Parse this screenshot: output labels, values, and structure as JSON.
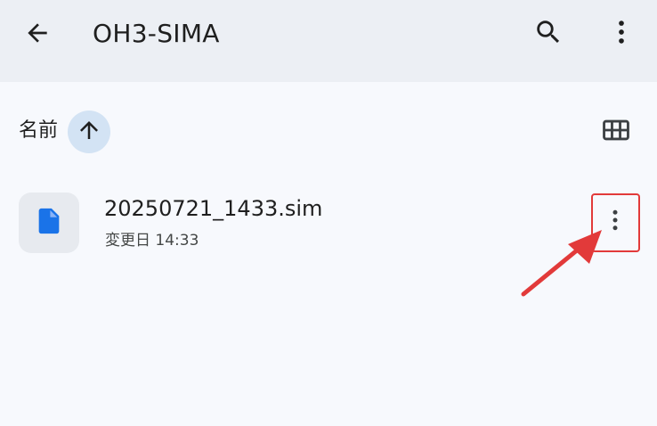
{
  "header": {
    "title": "OH3-SIMA",
    "back_icon": "arrow-back-icon",
    "search_icon": "search-icon",
    "more_icon": "more-vert-icon"
  },
  "toolbar": {
    "sort_label": "名前",
    "sort_icon": "arrow-up-icon",
    "view_icon": "grid-view-icon"
  },
  "files": [
    {
      "name": "20250721_1433.sim",
      "meta": "変更日 14:33",
      "icon": "document-icon",
      "more_icon": "more-vert-icon"
    }
  ],
  "annotation": {
    "highlight_color": "#e23a3a",
    "arrow_icon": "annotation-arrow-icon"
  },
  "colors": {
    "topbar_bg": "#eceff4",
    "page_bg": "#f7f9fd",
    "sort_chip_bg": "#d3e3f4",
    "file_icon": "#1a73e8"
  }
}
